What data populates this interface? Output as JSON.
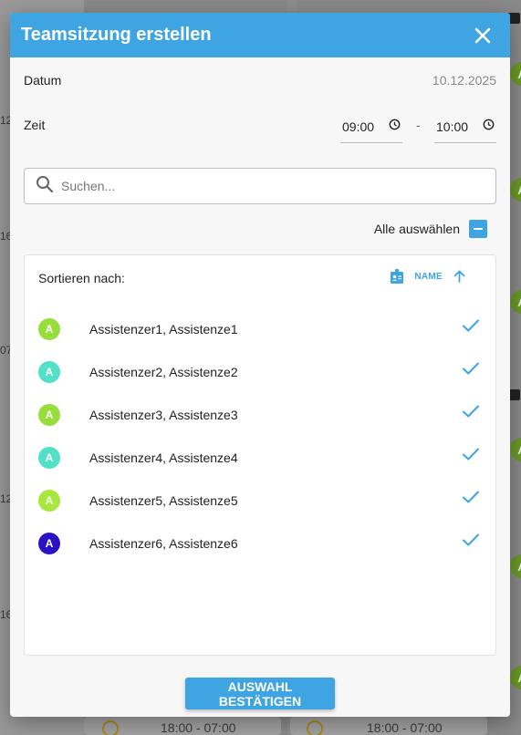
{
  "background": {
    "times": [
      "18:00 - 07:00",
      "18:00 - 07:00"
    ],
    "fragments": [
      "12",
      "16",
      "07",
      "12",
      "16"
    ],
    "avatar_letter": "A"
  },
  "dialog": {
    "title": "Teamsitzung erstellen",
    "close_icon": "close-icon",
    "date": {
      "label": "Datum",
      "value": "10.12.2025"
    },
    "time": {
      "label": "Zeit",
      "start": "09:00",
      "separator": "-",
      "end": "10:00"
    },
    "search": {
      "placeholder": "Suchen...",
      "value": ""
    },
    "select_all": {
      "label": "Alle auswählen",
      "state": "indeterminate"
    },
    "sort": {
      "label": "Sortieren nach:",
      "field": "NAME",
      "direction": "ascending"
    },
    "assistants": [
      {
        "initial": "A",
        "name": "Assistenzer1, Assistenze1",
        "color": "#97de3a",
        "selected": true
      },
      {
        "initial": "A",
        "name": "Assistenzer2, Assistenze2",
        "color": "#52e0c8",
        "selected": true
      },
      {
        "initial": "A",
        "name": "Assistenzer3, Assistenze3",
        "color": "#97de3a",
        "selected": true
      },
      {
        "initial": "A",
        "name": "Assistenzer4, Assistenze4",
        "color": "#52e0c8",
        "selected": true
      },
      {
        "initial": "A",
        "name": "Assistenzer5, Assistenze5",
        "color": "#a8e83c",
        "selected": true
      },
      {
        "initial": "A",
        "name": "Assistenzer6, Assistenze6",
        "color": "#2a13c4",
        "selected": true
      }
    ],
    "confirm_label": "AUSWAHL BESTÄTIGEN"
  },
  "colors": {
    "accent": "#3ea4e2",
    "header": "#3ea4e2"
  }
}
